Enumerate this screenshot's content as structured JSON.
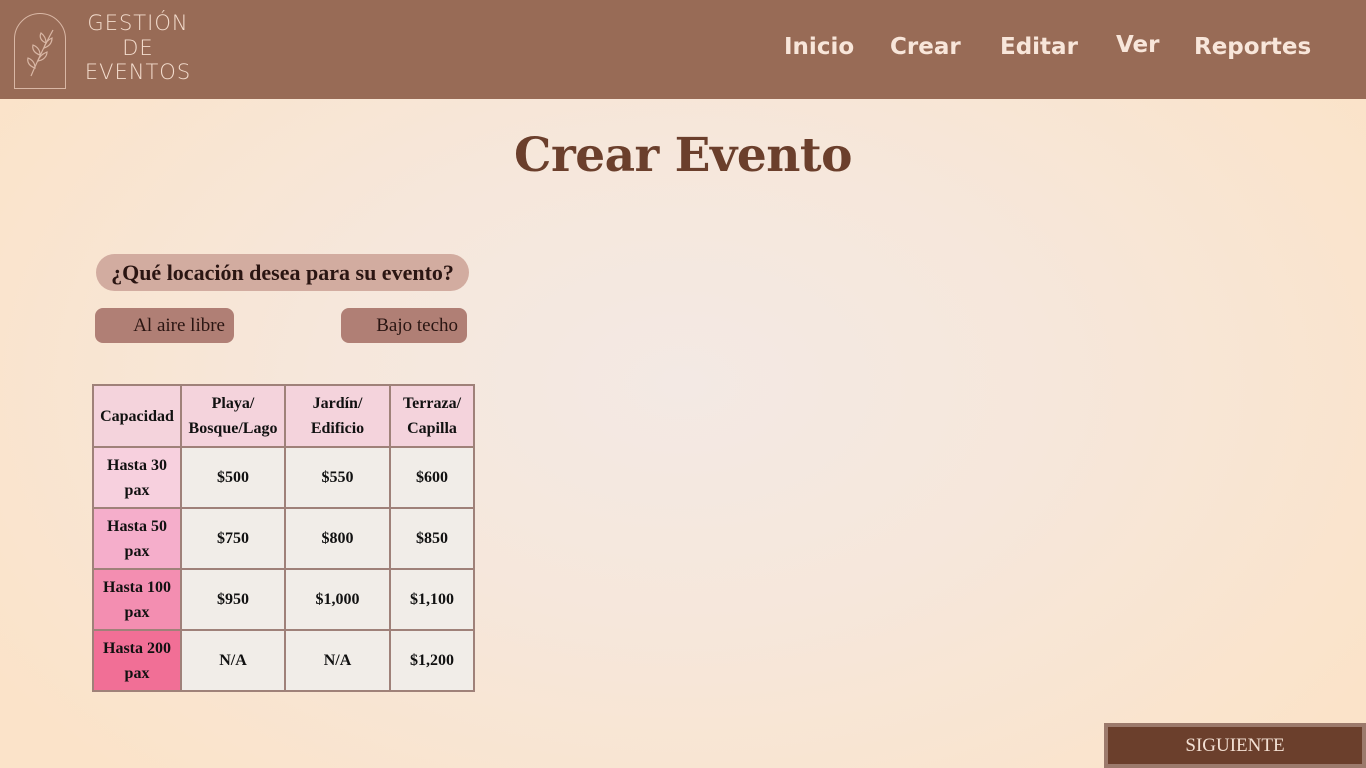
{
  "header": {
    "logo_line1": "GESTIÓN",
    "logo_line2": "DE",
    "logo_line3": "EVENTOS",
    "nav": [
      {
        "label": "Inicio"
      },
      {
        "label": "Crear"
      },
      {
        "label": "Editar"
      },
      {
        "label": "Ver"
      },
      {
        "label": "Reportes"
      }
    ]
  },
  "page": {
    "title": "Crear Evento",
    "question": "¿Qué locación desea para su evento?",
    "options": [
      "Al aire libre",
      "Bajo techo"
    ],
    "next_label": "SIGUIENTE"
  },
  "table": {
    "headers": [
      "Capacidad",
      "Playa/ Bosque/Lago",
      "Jardín/ Edificio",
      "Terraza/ Capilla"
    ],
    "rows": [
      {
        "label": "Hasta 30 pax",
        "values": [
          "$500",
          "$550",
          "$600"
        ]
      },
      {
        "label": "Hasta 50 pax",
        "values": [
          "$750",
          "$800",
          "$850"
        ]
      },
      {
        "label": "Hasta 100 pax",
        "values": [
          "$950",
          "$1,000",
          "$1,100"
        ]
      },
      {
        "label": "Hasta 200 pax",
        "values": [
          "N/A",
          "N/A",
          "$1,200"
        ]
      }
    ]
  },
  "colors": {
    "header_bg": "#986b56",
    "title": "#6b3f2c",
    "button_bg": "#6b3f2c"
  }
}
